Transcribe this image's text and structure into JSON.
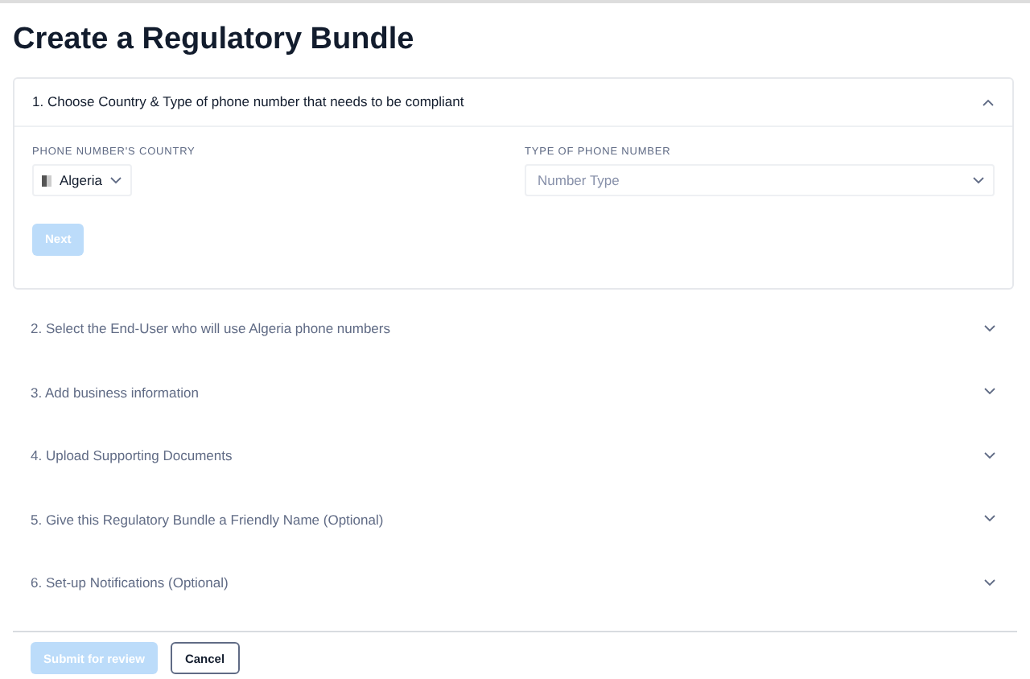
{
  "title": "Create a Regulatory Bundle",
  "steps": [
    {
      "label": "1. Choose Country & Type of phone number that needs to be compliant",
      "expanded": true
    },
    {
      "label": "2. Select the End-User who will use Algeria phone numbers",
      "expanded": false
    },
    {
      "label": "3. Add business information",
      "expanded": false
    },
    {
      "label": "4. Upload Supporting Documents",
      "expanded": false
    },
    {
      "label": "5. Give this Regulatory Bundle a Friendly Name (Optional)",
      "expanded": false
    },
    {
      "label": "6. Set-up Notifications (Optional)",
      "expanded": false
    }
  ],
  "country": {
    "label": "PHONE NUMBER'S COUNTRY",
    "value": "Algeria"
  },
  "number_type": {
    "label": "TYPE OF PHONE NUMBER",
    "placeholder": "Number Type"
  },
  "next_button": {
    "label": "Next",
    "disabled": true
  },
  "footer": [
    {
      "label": "Submit for review",
      "kind": "primary",
      "disabled": true
    },
    {
      "label": "Cancel",
      "kind": "secondary",
      "disabled": false
    }
  ]
}
